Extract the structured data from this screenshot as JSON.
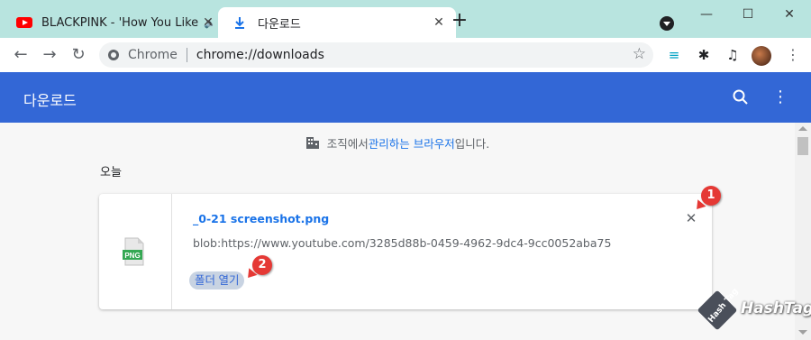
{
  "tabs": [
    {
      "title": "BLACKPINK - 'How You Like",
      "audio": "🔈",
      "close": "✕"
    },
    {
      "title": "다운로드",
      "close": "✕"
    }
  ],
  "new_tab": "+",
  "window_controls": {
    "minimize": "—",
    "maximize": "☐",
    "close": "✕"
  },
  "nav": {
    "back": "←",
    "forward": "→",
    "reload": "↻"
  },
  "omnibox": {
    "chip": "Chrome",
    "url": "chrome://downloads",
    "star": "☆"
  },
  "extensions": {
    "filter": "≡",
    "puzzle": "✱",
    "media": "♫",
    "menu": "⋮"
  },
  "header": {
    "title": "다운로드",
    "menu": "⋮"
  },
  "managed_note": {
    "prefix": "조직에서 ",
    "link": "관리하는 브라우저",
    "suffix": "입니다."
  },
  "date_label": "오늘",
  "download": {
    "file_name": "_0-21 screenshot.png",
    "file_url": "blob:https://www.youtube.com/3285d88b-0459-4962-9dc4-9cc0052aba75",
    "file_type": "PNG",
    "open_folder": "폴더 열기",
    "remove": "✕"
  },
  "badges": [
    "1",
    "2"
  ],
  "watermark": {
    "cube_text": "Hash Tag",
    "text": "HashTag"
  },
  "colors": {
    "header": "#3367d6",
    "tabstrip": "#b8e4df",
    "link": "#1a73e8",
    "badge": "#e53935"
  },
  "icons": [
    "youtube-icon",
    "download-icon",
    "tab-search-icon",
    "site-info-icon",
    "bookmark-star-icon",
    "filter-icon",
    "puzzle-icon",
    "media-icon",
    "search-icon",
    "building-icon",
    "png-file-icon",
    "close-icon"
  ]
}
